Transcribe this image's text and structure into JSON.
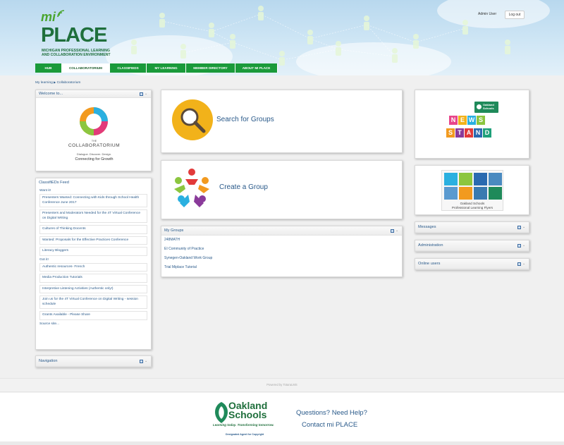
{
  "header": {
    "logo_mi": "mi",
    "logo_place": "PLACE",
    "logo_sub_1": "MICHIGAN PROFESSIONAL LEARNING",
    "logo_sub_2": "AND COLLABORATION ENVIRONMENT",
    "user_name": "Admin User",
    "logout_label": "Log out"
  },
  "nav": {
    "tabs": [
      {
        "label": "HUB",
        "active": false
      },
      {
        "label": "COLLABORATORIUM",
        "active": true
      },
      {
        "label": "CLASSIFIEDS",
        "active": false
      },
      {
        "label": "MY LEARNING",
        "active": false
      },
      {
        "label": "MEMBER DIRECTORY",
        "active": false
      },
      {
        "label": "ABOUT MI PLACE",
        "active": false
      }
    ]
  },
  "breadcrumb": {
    "home": "My learning",
    "separator": "▶",
    "current": "Collaboratorium"
  },
  "welcome": {
    "title": "Welcome to...",
    "logo_the": "THE",
    "logo_name": "COLLABORATORIUM",
    "logo_tagline": "Dialogue. Discover. Design.",
    "logo_slogan": "Connecting for Growth"
  },
  "classifieds": {
    "title": "ClassifiEDs Feed",
    "want_label": "Want it!",
    "want_items": [
      "Presenters Wanted: Connecting with Kids through School Health Conference June 2017",
      "Presenters and Moderators Needed for the 4T Virtual Conference on Digital Writing",
      "Cultures of Thinking Docents",
      "Wanted: Proposals for the Effective Practices Conference",
      "Literacy Bloggers"
    ],
    "got_label": "Got it!",
    "got_items": [
      "Authentic resources- French",
      "Media Production Tutorials",
      "Interpretive Listening Activities (Authentic only!)",
      "Join us for the 4T Virtual Conference on Digital Writing - session schedule",
      "Grants Available - Please Share"
    ],
    "source_link": "Source site..."
  },
  "navigation": {
    "title": "Navigation"
  },
  "search_groups": {
    "label": "Search for Groups"
  },
  "create_group": {
    "label": "Create a Group"
  },
  "my_groups": {
    "title": "My Groups",
    "items": [
      "248MATH",
      "EI Community of Practice",
      "Synegen-Oakland Work Group",
      "Trial Miplace Tutorial"
    ]
  },
  "newsstand": {
    "brand": "Oakland Schools",
    "letters_top": [
      "N",
      "E",
      "W",
      "S"
    ],
    "letters_bottom": [
      "S",
      "T",
      "A",
      "N",
      "D"
    ]
  },
  "flyers": {
    "caption_1": "Oakland Schools",
    "caption_2": "Professional Learning Flyers"
  },
  "side_blocks": [
    "Messages",
    "Administration",
    "Online users"
  ],
  "footer": {
    "powered_by": "Powered by TotaraLMS",
    "oakland_1": "Oakland",
    "oakland_2": "Schools",
    "tagline": "Learning today. Transforming tomorrow.",
    "agent": "Designated Agent for Copyright",
    "questions": "Questions? Need Help?",
    "contact": "Contact mi PLACE"
  },
  "colors": {
    "nav_green": "#1a9a3a",
    "link_blue": "#2a5a8a",
    "brand_dark_green": "#1f6f3c",
    "search_yellow": "#f2b21a"
  }
}
